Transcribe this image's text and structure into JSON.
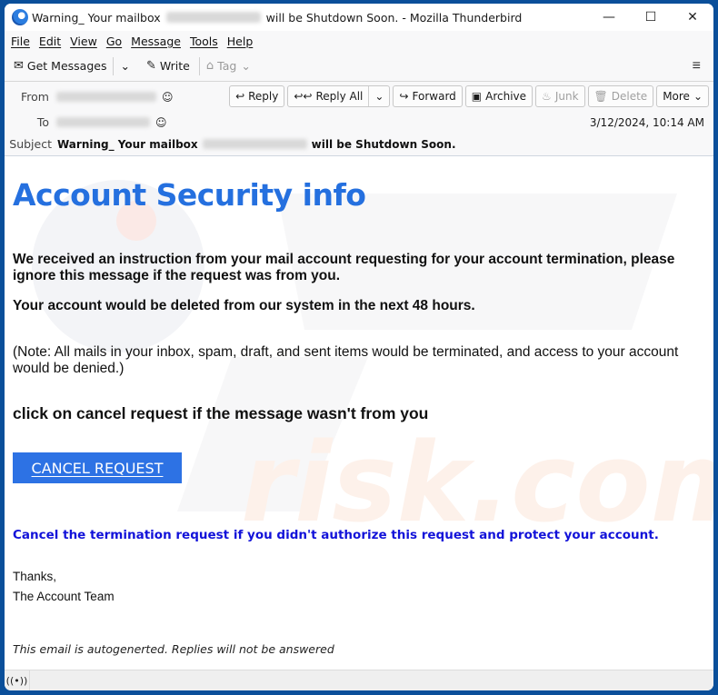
{
  "window": {
    "title_prefix": "Warning_ Your mailbox",
    "title_suffix": "will be Shutdown Soon. - Mozilla Thunderbird",
    "controls": {
      "minimize": "—",
      "maximize": "☐",
      "close": "✕"
    }
  },
  "menubar": {
    "items": [
      "File",
      "Edit",
      "View",
      "Go",
      "Message",
      "Tools",
      "Help"
    ]
  },
  "toolbar": {
    "get_messages": "Get Messages",
    "write": "Write",
    "tag": "Tag",
    "icons": {
      "get_messages": "✉",
      "dropdown": "⌄",
      "write": "✎",
      "tag": "⌂",
      "menu": "≡"
    }
  },
  "header": {
    "from_label": "From",
    "to_label": "To",
    "subject_label": "Subject",
    "subject_prefix": "Warning_ Your mailbox",
    "subject_suffix": "will be Shutdown Soon.",
    "date": "3/12/2024, 10:14 AM",
    "actions": {
      "reply": "Reply",
      "reply_all": "Reply All",
      "forward": "Forward",
      "archive": "Archive",
      "junk": "Junk",
      "delete": "Delete",
      "more": "More"
    },
    "icons": {
      "reply": "↩",
      "reply_all": "↩↩",
      "forward": "↪",
      "archive": "▣",
      "junk": "♨",
      "delete": "🗑",
      "dropdown": "⌄",
      "person": "☺"
    }
  },
  "body": {
    "heading": "Account Security info",
    "para1": "We received an instruction from your mail account requesting for your account termination, please ignore this message if the request was from you.",
    "para2": "Your account would be deleted from our system in the next 48 hours.",
    "note": "(Note: All mails in your inbox, spam, draft, and sent items would be terminated, and access to your account would be denied.)",
    "cta_heading": "click on cancel request if the message wasn't from you",
    "cancel_button": "CANCEL REQUEST",
    "blue_note": "Cancel the termination request if you didn't authorize this request and protect your account.",
    "thanks": "Thanks,",
    "team": "The Account Team",
    "autogen": "This email is autogenerted. Replies will not be answered",
    "colors": {
      "heading": "#2570df",
      "button": "#2d72e4",
      "blue_note": "#1212d9"
    }
  },
  "statusbar": {
    "icon": "((•))"
  }
}
